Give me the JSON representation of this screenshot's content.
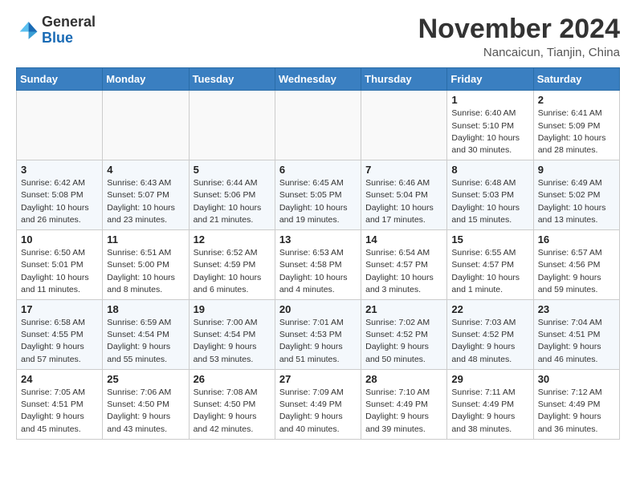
{
  "header": {
    "logo_general": "General",
    "logo_blue": "Blue",
    "month_title": "November 2024",
    "location": "Nancaicun, Tianjin, China"
  },
  "weekdays": [
    "Sunday",
    "Monday",
    "Tuesday",
    "Wednesday",
    "Thursday",
    "Friday",
    "Saturday"
  ],
  "weeks": [
    [
      {
        "day": "",
        "detail": ""
      },
      {
        "day": "",
        "detail": ""
      },
      {
        "day": "",
        "detail": ""
      },
      {
        "day": "",
        "detail": ""
      },
      {
        "day": "",
        "detail": ""
      },
      {
        "day": "1",
        "detail": "Sunrise: 6:40 AM\nSunset: 5:10 PM\nDaylight: 10 hours\nand 30 minutes."
      },
      {
        "day": "2",
        "detail": "Sunrise: 6:41 AM\nSunset: 5:09 PM\nDaylight: 10 hours\nand 28 minutes."
      }
    ],
    [
      {
        "day": "3",
        "detail": "Sunrise: 6:42 AM\nSunset: 5:08 PM\nDaylight: 10 hours\nand 26 minutes."
      },
      {
        "day": "4",
        "detail": "Sunrise: 6:43 AM\nSunset: 5:07 PM\nDaylight: 10 hours\nand 23 minutes."
      },
      {
        "day": "5",
        "detail": "Sunrise: 6:44 AM\nSunset: 5:06 PM\nDaylight: 10 hours\nand 21 minutes."
      },
      {
        "day": "6",
        "detail": "Sunrise: 6:45 AM\nSunset: 5:05 PM\nDaylight: 10 hours\nand 19 minutes."
      },
      {
        "day": "7",
        "detail": "Sunrise: 6:46 AM\nSunset: 5:04 PM\nDaylight: 10 hours\nand 17 minutes."
      },
      {
        "day": "8",
        "detail": "Sunrise: 6:48 AM\nSunset: 5:03 PM\nDaylight: 10 hours\nand 15 minutes."
      },
      {
        "day": "9",
        "detail": "Sunrise: 6:49 AM\nSunset: 5:02 PM\nDaylight: 10 hours\nand 13 minutes."
      }
    ],
    [
      {
        "day": "10",
        "detail": "Sunrise: 6:50 AM\nSunset: 5:01 PM\nDaylight: 10 hours\nand 11 minutes."
      },
      {
        "day": "11",
        "detail": "Sunrise: 6:51 AM\nSunset: 5:00 PM\nDaylight: 10 hours\nand 8 minutes."
      },
      {
        "day": "12",
        "detail": "Sunrise: 6:52 AM\nSunset: 4:59 PM\nDaylight: 10 hours\nand 6 minutes."
      },
      {
        "day": "13",
        "detail": "Sunrise: 6:53 AM\nSunset: 4:58 PM\nDaylight: 10 hours\nand 4 minutes."
      },
      {
        "day": "14",
        "detail": "Sunrise: 6:54 AM\nSunset: 4:57 PM\nDaylight: 10 hours\nand 3 minutes."
      },
      {
        "day": "15",
        "detail": "Sunrise: 6:55 AM\nSunset: 4:57 PM\nDaylight: 10 hours\nand 1 minute."
      },
      {
        "day": "16",
        "detail": "Sunrise: 6:57 AM\nSunset: 4:56 PM\nDaylight: 9 hours\nand 59 minutes."
      }
    ],
    [
      {
        "day": "17",
        "detail": "Sunrise: 6:58 AM\nSunset: 4:55 PM\nDaylight: 9 hours\nand 57 minutes."
      },
      {
        "day": "18",
        "detail": "Sunrise: 6:59 AM\nSunset: 4:54 PM\nDaylight: 9 hours\nand 55 minutes."
      },
      {
        "day": "19",
        "detail": "Sunrise: 7:00 AM\nSunset: 4:54 PM\nDaylight: 9 hours\nand 53 minutes."
      },
      {
        "day": "20",
        "detail": "Sunrise: 7:01 AM\nSunset: 4:53 PM\nDaylight: 9 hours\nand 51 minutes."
      },
      {
        "day": "21",
        "detail": "Sunrise: 7:02 AM\nSunset: 4:52 PM\nDaylight: 9 hours\nand 50 minutes."
      },
      {
        "day": "22",
        "detail": "Sunrise: 7:03 AM\nSunset: 4:52 PM\nDaylight: 9 hours\nand 48 minutes."
      },
      {
        "day": "23",
        "detail": "Sunrise: 7:04 AM\nSunset: 4:51 PM\nDaylight: 9 hours\nand 46 minutes."
      }
    ],
    [
      {
        "day": "24",
        "detail": "Sunrise: 7:05 AM\nSunset: 4:51 PM\nDaylight: 9 hours\nand 45 minutes."
      },
      {
        "day": "25",
        "detail": "Sunrise: 7:06 AM\nSunset: 4:50 PM\nDaylight: 9 hours\nand 43 minutes."
      },
      {
        "day": "26",
        "detail": "Sunrise: 7:08 AM\nSunset: 4:50 PM\nDaylight: 9 hours\nand 42 minutes."
      },
      {
        "day": "27",
        "detail": "Sunrise: 7:09 AM\nSunset: 4:49 PM\nDaylight: 9 hours\nand 40 minutes."
      },
      {
        "day": "28",
        "detail": "Sunrise: 7:10 AM\nSunset: 4:49 PM\nDaylight: 9 hours\nand 39 minutes."
      },
      {
        "day": "29",
        "detail": "Sunrise: 7:11 AM\nSunset: 4:49 PM\nDaylight: 9 hours\nand 38 minutes."
      },
      {
        "day": "30",
        "detail": "Sunrise: 7:12 AM\nSunset: 4:49 PM\nDaylight: 9 hours\nand 36 minutes."
      }
    ]
  ]
}
